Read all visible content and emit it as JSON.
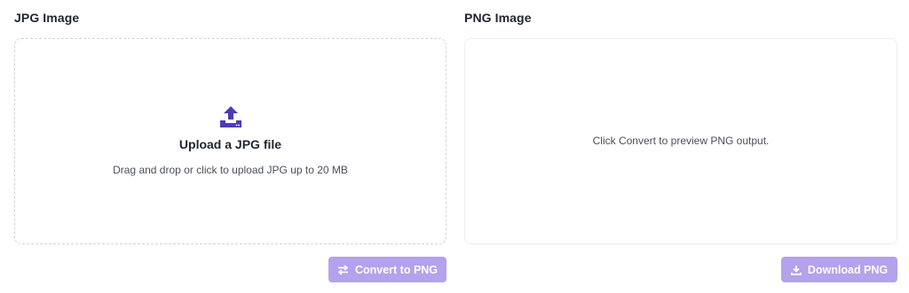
{
  "input_panel": {
    "title": "JPG Image",
    "upload_title": "Upload a JPG file",
    "upload_subtitle": "Drag and drop or click to upload JPG up to 20 MB",
    "upload_icon": "upload-icon"
  },
  "output_panel": {
    "title": "PNG Image",
    "preview_placeholder": "Click Convert to preview PNG output."
  },
  "actions": {
    "convert_label": "Convert to PNG",
    "convert_icon": "swap-arrows-icon",
    "download_label": "Download PNG",
    "download_icon": "download-icon"
  },
  "colors": {
    "accent": "#b3a2ec",
    "icon_accent": "#4b3bb5",
    "border": "#cfd3da",
    "text": "#1f2430",
    "muted_text": "#4a4f5a"
  }
}
